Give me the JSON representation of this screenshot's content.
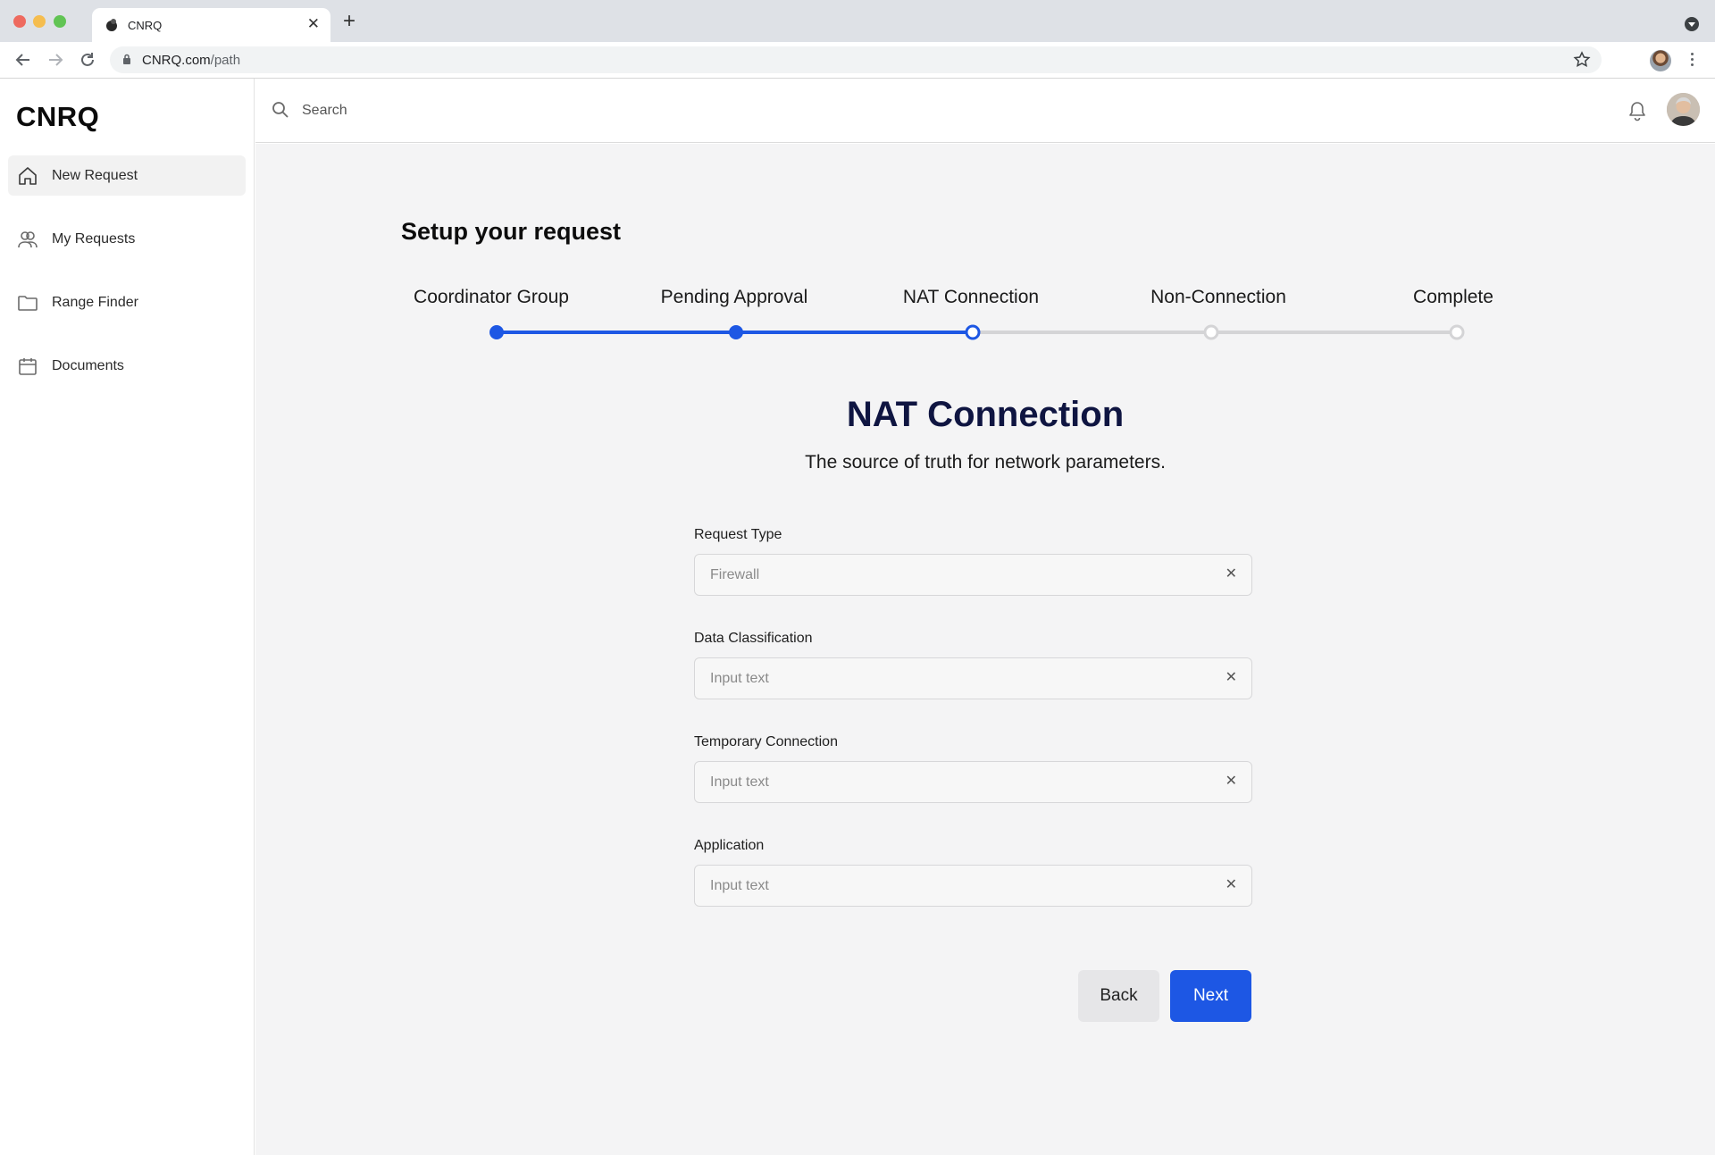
{
  "browser": {
    "tab_title": "CNRQ",
    "url_host": "CNRQ.com",
    "url_path": "/path"
  },
  "sidebar": {
    "logo": "CNRQ",
    "items": [
      {
        "label": "New Request",
        "icon": "home-icon",
        "active": true
      },
      {
        "label": "My Requests",
        "icon": "users-icon",
        "active": false
      },
      {
        "label": "Range Finder",
        "icon": "folder-icon",
        "active": false
      },
      {
        "label": "Documents",
        "icon": "calendar-icon",
        "active": false
      }
    ]
  },
  "header": {
    "search_placeholder": "Search",
    "icons": [
      "search-icon",
      "bell-icon",
      "avatar"
    ]
  },
  "main": {
    "title": "Setup your request",
    "steps": [
      {
        "label": "Coordinator Group",
        "state": "done"
      },
      {
        "label": "Pending Approval",
        "state": "done"
      },
      {
        "label": "NAT Connection",
        "state": "current"
      },
      {
        "label": "Non-Connection",
        "state": "todo"
      },
      {
        "label": "Complete",
        "state": "todo"
      }
    ],
    "form_title": "NAT Connection",
    "form_subtitle": "The source of truth for network parameters.",
    "fields": [
      {
        "label": "Request Type",
        "value": "Firewall",
        "placeholder": ""
      },
      {
        "label": "Data Classification",
        "value": "",
        "placeholder": "Input text"
      },
      {
        "label": "Temporary Connection",
        "value": "",
        "placeholder": "Input text"
      },
      {
        "label": "Application",
        "value": "",
        "placeholder": "Input text"
      }
    ],
    "back_label": "Back",
    "next_label": "Next"
  },
  "colors": {
    "accent": "#1d57e4",
    "heading": "#0f1541",
    "track_inactive": "#d4d4d6",
    "background": "#f4f4f5"
  }
}
